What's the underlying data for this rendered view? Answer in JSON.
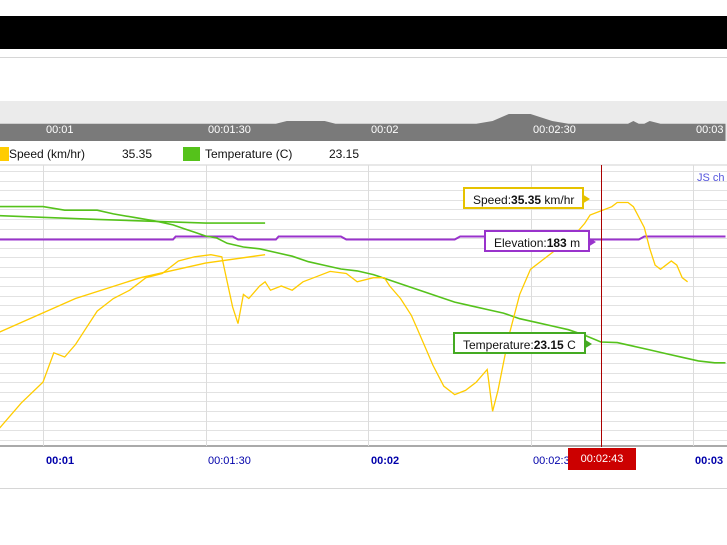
{
  "chart_data": {
    "type": "line",
    "title": "",
    "x_ticks": [
      {
        "time": "00:01",
        "seconds": 60,
        "major": true
      },
      {
        "time": "00:01:30",
        "seconds": 90,
        "major": false
      },
      {
        "time": "00:02",
        "seconds": 120,
        "major": true
      },
      {
        "time": "00:02:30",
        "seconds": 150,
        "major": false
      },
      {
        "time": "00:03",
        "seconds": 180,
        "major": true
      }
    ],
    "xlim_seconds": [
      52,
      186
    ],
    "grid": true,
    "cursor": {
      "time": "00:02:43",
      "seconds": 163
    },
    "series": [
      {
        "name": "Speed",
        "unit": "km/hr",
        "color": "#ffcc00",
        "current": "35.35",
        "points": [
          [
            52,
            4
          ],
          [
            56,
            10
          ],
          [
            60,
            15
          ],
          [
            62,
            22
          ],
          [
            64,
            21
          ],
          [
            66,
            24
          ],
          [
            68,
            28
          ],
          [
            70,
            32
          ],
          [
            73,
            35
          ],
          [
            76,
            37
          ],
          [
            79,
            40
          ],
          [
            82,
            41
          ],
          [
            85,
            44
          ],
          [
            88,
            45
          ],
          [
            91,
            45.5
          ],
          [
            93,
            45
          ],
          [
            95,
            33
          ],
          [
            96,
            29
          ],
          [
            97,
            36
          ],
          [
            98,
            35
          ],
          [
            100,
            38
          ],
          [
            101,
            39
          ],
          [
            102,
            37
          ],
          [
            104,
            38
          ],
          [
            106,
            37
          ],
          [
            108,
            39
          ],
          [
            110,
            40
          ],
          [
            113,
            41.5
          ],
          [
            116,
            41
          ],
          [
            118,
            39
          ],
          [
            121,
            40
          ],
          [
            123,
            40
          ],
          [
            124,
            38
          ],
          [
            126,
            35
          ],
          [
            128,
            31
          ],
          [
            129,
            28
          ],
          [
            131,
            22
          ],
          [
            132,
            19
          ],
          [
            134,
            14
          ],
          [
            136,
            12
          ],
          [
            138,
            13
          ],
          [
            140,
            15
          ],
          [
            142,
            18
          ],
          [
            143,
            8
          ],
          [
            144,
            13
          ],
          [
            146,
            26
          ],
          [
            148,
            36
          ],
          [
            150,
            42
          ],
          [
            152,
            44
          ],
          [
            154,
            46
          ],
          [
            156,
            48
          ],
          [
            158,
            50
          ],
          [
            160,
            53
          ],
          [
            161,
            55
          ],
          [
            163,
            56
          ],
          [
            165,
            57
          ],
          [
            166,
            58
          ],
          [
            168,
            58
          ],
          [
            169,
            57
          ],
          [
            171,
            52
          ],
          [
            172,
            47
          ],
          [
            173,
            43
          ],
          [
            174,
            42
          ],
          [
            176,
            44
          ],
          [
            177,
            43
          ],
          [
            178,
            40
          ],
          [
            179,
            39
          ]
        ]
      },
      {
        "name": "Temperature",
        "unit": "C",
        "color": "#55c21b",
        "current": "23.15",
        "points": [
          [
            52,
            60
          ],
          [
            60,
            60
          ],
          [
            64,
            59
          ],
          [
            70,
            59
          ],
          [
            73,
            58
          ],
          [
            77,
            57
          ],
          [
            81,
            56
          ],
          [
            84,
            55
          ],
          [
            86,
            54
          ],
          [
            88,
            53
          ],
          [
            90,
            52
          ],
          [
            92,
            51.5
          ],
          [
            94,
            50
          ],
          [
            97,
            49
          ],
          [
            100,
            48.5
          ],
          [
            103,
            47.5
          ],
          [
            106,
            46.5
          ],
          [
            109,
            45
          ],
          [
            112,
            44
          ],
          [
            115,
            43
          ],
          [
            118,
            42.5
          ],
          [
            121,
            41.5
          ],
          [
            124,
            40
          ],
          [
            127,
            38.5
          ],
          [
            130,
            37
          ],
          [
            133,
            35.5
          ],
          [
            136,
            34
          ],
          [
            139,
            33
          ],
          [
            142,
            32
          ],
          [
            145,
            31
          ],
          [
            148,
            29.5
          ],
          [
            151,
            28.5
          ],
          [
            154,
            27.5
          ],
          [
            157,
            26.5
          ],
          [
            160,
            25
          ],
          [
            163,
            23.15
          ],
          [
            166,
            23
          ],
          [
            169,
            22
          ],
          [
            172,
            21
          ],
          [
            175,
            20
          ],
          [
            178,
            19
          ],
          [
            181,
            18
          ],
          [
            184,
            17.5
          ],
          [
            186,
            17.5
          ]
        ]
      },
      {
        "name": "Elevation",
        "unit": "m",
        "color": "#9933cc",
        "current": "183",
        "points": [
          [
            52,
            183
          ],
          [
            84,
            183
          ],
          [
            84.5,
            184
          ],
          [
            95,
            184
          ],
          [
            96,
            183
          ],
          [
            103,
            183
          ],
          [
            103.5,
            184
          ],
          [
            115,
            184
          ],
          [
            116,
            183
          ],
          [
            136,
            183
          ],
          [
            137,
            184
          ],
          [
            141,
            184
          ],
          [
            146,
            184
          ],
          [
            156,
            184
          ],
          [
            158,
            183
          ],
          [
            163,
            183
          ],
          [
            170,
            183
          ],
          [
            171,
            184
          ],
          [
            186,
            184
          ]
        ]
      }
    ],
    "lap_overlay": {
      "speed": [
        [
          52,
          27
        ],
        [
          66,
          35
        ],
        [
          78,
          40
        ],
        [
          90,
          43.5
        ],
        [
          101,
          45.5
        ]
      ],
      "temperature": [
        [
          52,
          57.5
        ],
        [
          70,
          56.5
        ],
        [
          90,
          55.5
        ],
        [
          101,
          55.5
        ]
      ]
    },
    "navigator": {
      "points": [
        [
          52,
          0.3
        ],
        [
          66,
          0.3
        ],
        [
          68,
          0.3
        ],
        [
          90,
          0.3
        ],
        [
          101,
          0.3
        ],
        [
          103,
          0.3
        ],
        [
          105,
          0.5
        ],
        [
          112,
          0.5
        ],
        [
          114,
          0.3
        ],
        [
          140,
          0.3
        ],
        [
          143,
          0.5
        ],
        [
          146,
          1
        ],
        [
          150,
          1
        ],
        [
          154,
          0.5
        ],
        [
          157,
          0.3
        ],
        [
          168,
          0.3
        ],
        [
          169,
          0.5
        ],
        [
          170,
          0.3
        ],
        [
          171,
          0.3
        ],
        [
          172,
          0.5
        ],
        [
          174,
          0.3
        ],
        [
          186,
          0.3
        ]
      ]
    }
  },
  "legend": {
    "speed_label": "Speed (km/hr)",
    "speed_value": "35.35",
    "temperature_label": "Temperature (C)",
    "temperature_value": "23.15"
  },
  "tooltips": {
    "speed_label": "Speed:",
    "speed_value": "35.35",
    "speed_unit": " km/hr",
    "elevation_label": "Elevation:",
    "elevation_value": "183",
    "elevation_unit": " m",
    "temperature_label": "Temperature:",
    "temperature_value": "23.15",
    "temperature_unit": " C"
  },
  "cursor_label": "00:02:43",
  "credit": "JS ch"
}
